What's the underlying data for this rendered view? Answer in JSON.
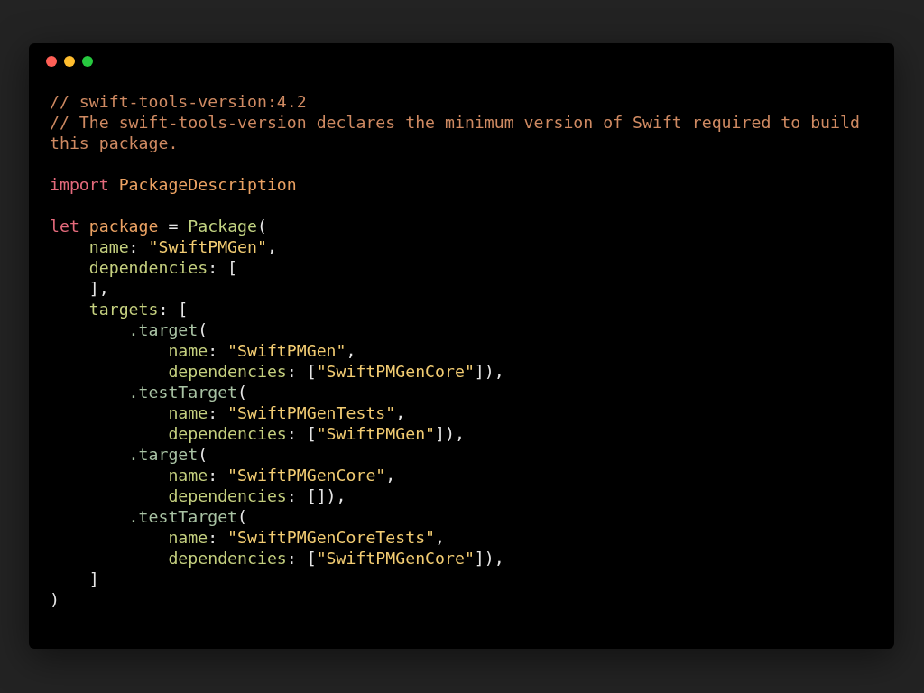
{
  "window": {
    "controls": [
      {
        "color": "#ff5f56"
      },
      {
        "color": "#ffbd2e"
      },
      {
        "color": "#27c93f"
      }
    ]
  },
  "code": {
    "blocks": [
      [
        {
          "tokens": [
            {
              "kind": "comment",
              "text": "// swift-tools-version:4.2"
            }
          ]
        },
        {
          "tokens": [
            {
              "kind": "comment",
              "text": "// The swift-tools-version declares the minimum version of Swift required to build this package."
            }
          ]
        }
      ],
      [
        {
          "tokens": [
            {
              "kind": "keyword",
              "text": "import "
            },
            {
              "kind": "type",
              "text": "PackageDescription"
            }
          ]
        }
      ],
      [
        {
          "tokens": [
            {
              "kind": "keyword",
              "text": "let "
            },
            {
              "kind": "type",
              "text": "package"
            },
            {
              "kind": "punct",
              "text": " = "
            },
            {
              "kind": "call",
              "text": "Package"
            },
            {
              "kind": "punct",
              "text": "("
            }
          ],
          "children": [
            {
              "tokens": [
                {
                  "kind": "property",
                  "text": "name"
                },
                {
                  "kind": "punct",
                  "text": ": "
                },
                {
                  "kind": "string",
                  "text": "\"SwiftPMGen\""
                },
                {
                  "kind": "punct",
                  "text": ","
                }
              ]
            },
            {
              "tokens": [
                {
                  "kind": "property",
                  "text": "dependencies"
                },
                {
                  "kind": "punct",
                  "text": ": ["
                }
              ]
            },
            {
              "tokens": [
                {
                  "kind": "punct",
                  "text": "],"
                }
              ]
            },
            {
              "tokens": [
                {
                  "kind": "property",
                  "text": "targets"
                },
                {
                  "kind": "punct",
                  "text": ": ["
                }
              ],
              "children": [
                {
                  "tokens": [
                    {
                      "kind": "method",
                      "text": ".target"
                    },
                    {
                      "kind": "punct",
                      "text": "("
                    }
                  ],
                  "children": [
                    {
                      "tokens": [
                        {
                          "kind": "property",
                          "text": "name"
                        },
                        {
                          "kind": "punct",
                          "text": ": "
                        },
                        {
                          "kind": "string",
                          "text": "\"SwiftPMGen\""
                        },
                        {
                          "kind": "punct",
                          "text": ","
                        }
                      ]
                    },
                    {
                      "tokens": [
                        {
                          "kind": "property",
                          "text": "dependencies"
                        },
                        {
                          "kind": "punct",
                          "text": ": ["
                        },
                        {
                          "kind": "string",
                          "text": "\"SwiftPMGenCore\""
                        },
                        {
                          "kind": "punct",
                          "text": "]),"
                        }
                      ]
                    }
                  ]
                },
                {
                  "tokens": [
                    {
                      "kind": "method",
                      "text": ".testTarget"
                    },
                    {
                      "kind": "punct",
                      "text": "("
                    }
                  ],
                  "children": [
                    {
                      "tokens": [
                        {
                          "kind": "property",
                          "text": "name"
                        },
                        {
                          "kind": "punct",
                          "text": ": "
                        },
                        {
                          "kind": "string",
                          "text": "\"SwiftPMGenTests\""
                        },
                        {
                          "kind": "punct",
                          "text": ","
                        }
                      ]
                    },
                    {
                      "tokens": [
                        {
                          "kind": "property",
                          "text": "dependencies"
                        },
                        {
                          "kind": "punct",
                          "text": ": ["
                        },
                        {
                          "kind": "string",
                          "text": "\"SwiftPMGen\""
                        },
                        {
                          "kind": "punct",
                          "text": "]),"
                        }
                      ]
                    }
                  ]
                },
                {
                  "tokens": [
                    {
                      "kind": "method",
                      "text": ".target"
                    },
                    {
                      "kind": "punct",
                      "text": "("
                    }
                  ],
                  "children": [
                    {
                      "tokens": [
                        {
                          "kind": "property",
                          "text": "name"
                        },
                        {
                          "kind": "punct",
                          "text": ": "
                        },
                        {
                          "kind": "string",
                          "text": "\"SwiftPMGenCore\""
                        },
                        {
                          "kind": "punct",
                          "text": ","
                        }
                      ]
                    },
                    {
                      "tokens": [
                        {
                          "kind": "property",
                          "text": "dependencies"
                        },
                        {
                          "kind": "punct",
                          "text": ": []),"
                        }
                      ]
                    }
                  ]
                },
                {
                  "tokens": [
                    {
                      "kind": "method",
                      "text": ".testTarget"
                    },
                    {
                      "kind": "punct",
                      "text": "("
                    }
                  ],
                  "children": [
                    {
                      "tokens": [
                        {
                          "kind": "property",
                          "text": "name"
                        },
                        {
                          "kind": "punct",
                          "text": ": "
                        },
                        {
                          "kind": "string",
                          "text": "\"SwiftPMGenCoreTests\""
                        },
                        {
                          "kind": "punct",
                          "text": ","
                        }
                      ]
                    },
                    {
                      "tokens": [
                        {
                          "kind": "property",
                          "text": "dependencies"
                        },
                        {
                          "kind": "punct",
                          "text": ": ["
                        },
                        {
                          "kind": "string",
                          "text": "\"SwiftPMGenCore\""
                        },
                        {
                          "kind": "punct",
                          "text": "]),"
                        }
                      ]
                    }
                  ]
                }
              ]
            },
            {
              "tokens": [
                {
                  "kind": "punct",
                  "text": "]"
                }
              ]
            }
          ]
        },
        {
          "tokens": [
            {
              "kind": "punct",
              "text": ")"
            }
          ]
        }
      ]
    ]
  }
}
